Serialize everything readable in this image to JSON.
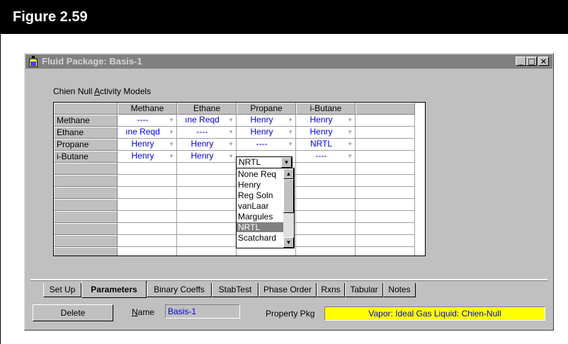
{
  "figure": {
    "title": "Figure 2.59"
  },
  "window": {
    "title": "Fluid Package: Basis-1",
    "min_label": "_",
    "max_label": "□",
    "close_label": "×"
  },
  "section": {
    "label_pre": "Chien Null ",
    "label_u": "A",
    "label_post": "ctivity Models"
  },
  "grid": {
    "columns": [
      "Methane",
      "Ethane",
      "Propane",
      "i-Butane"
    ],
    "rows": [
      {
        "name": "Methane",
        "cells": [
          "----",
          "ıne Reqd",
          "Henry",
          "Henry"
        ]
      },
      {
        "name": "Ethane",
        "cells": [
          "ıne Reqd",
          "----",
          "Henry",
          "Henry"
        ]
      },
      {
        "name": "Propane",
        "cells": [
          "Henry",
          "Henry",
          "----",
          "NRTL"
        ]
      },
      {
        "name": "i-Butane",
        "cells": [
          "Henry",
          "Henry",
          "NRTL",
          "----"
        ]
      }
    ],
    "editing_value": "NRTL",
    "dropdown_options": [
      "None Req",
      "Henry",
      "Reg Soln",
      "vanLaar",
      "Margules",
      "NRTL",
      "Scatchard"
    ],
    "selected_option": "NRTL"
  },
  "tabs": [
    "Set Up",
    "Parameters",
    "Binary Coeffs",
    "StabTest",
    "Phase Order",
    "Rxns",
    "Tabular",
    "Notes"
  ],
  "active_tab": "Parameters",
  "footer": {
    "delete_label": "Delete",
    "name_label_u": "N",
    "name_label_rest": "ame",
    "name_value": "Basis-1",
    "property_pkg_label": "Property Pkg",
    "property_pkg_value": "Vapor: Ideal Gas    Liquid: Chien-Null"
  },
  "colors": {
    "accent_value": "#0000e0",
    "pkg_background": "#ffff00",
    "window_face": "#c0c0c0"
  },
  "icons": [
    "app-icon",
    "minimize-icon",
    "maximize-icon",
    "close-icon",
    "dropdown-arrow-icon",
    "scroll-up-icon",
    "scroll-down-icon"
  ]
}
